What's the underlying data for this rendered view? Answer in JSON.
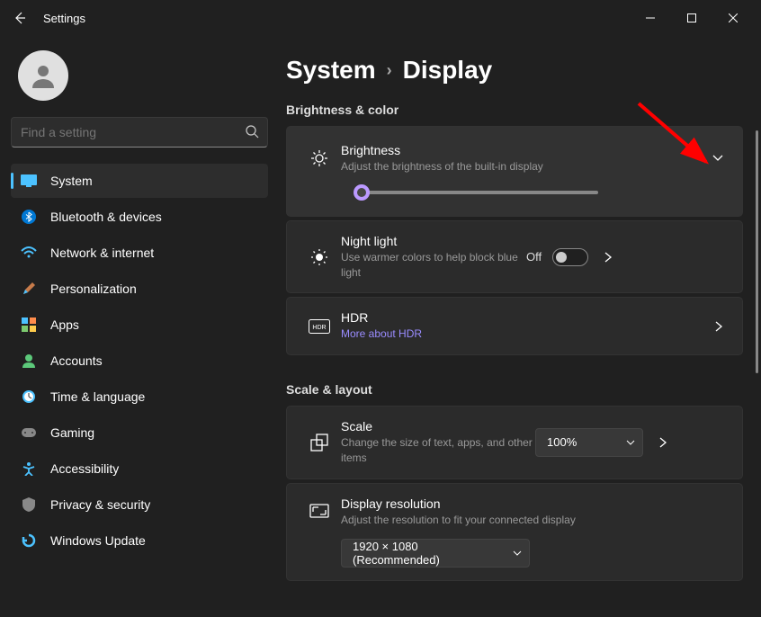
{
  "window": {
    "title": "Settings"
  },
  "search": {
    "placeholder": "Find a setting"
  },
  "nav": {
    "items": [
      {
        "label": "System"
      },
      {
        "label": "Bluetooth & devices"
      },
      {
        "label": "Network & internet"
      },
      {
        "label": "Personalization"
      },
      {
        "label": "Apps"
      },
      {
        "label": "Accounts"
      },
      {
        "label": "Time & language"
      },
      {
        "label": "Gaming"
      },
      {
        "label": "Accessibility"
      },
      {
        "label": "Privacy & security"
      },
      {
        "label": "Windows Update"
      }
    ]
  },
  "breadcrumb": {
    "parent": "System",
    "current": "Display"
  },
  "sections": {
    "brightness_color": "Brightness & color",
    "scale_layout": "Scale & layout"
  },
  "cards": {
    "brightness": {
      "title": "Brightness",
      "desc": "Adjust the brightness of the built-in display"
    },
    "nightlight": {
      "title": "Night light",
      "desc": "Use warmer colors to help block blue light",
      "state": "Off"
    },
    "hdr": {
      "title": "HDR",
      "link": "More about HDR"
    },
    "scale": {
      "title": "Scale",
      "desc": "Change the size of text, apps, and other items",
      "value": "100%"
    },
    "resolution": {
      "title": "Display resolution",
      "desc": "Adjust the resolution to fit your connected display",
      "value": "1920 × 1080 (Recommended)"
    }
  }
}
